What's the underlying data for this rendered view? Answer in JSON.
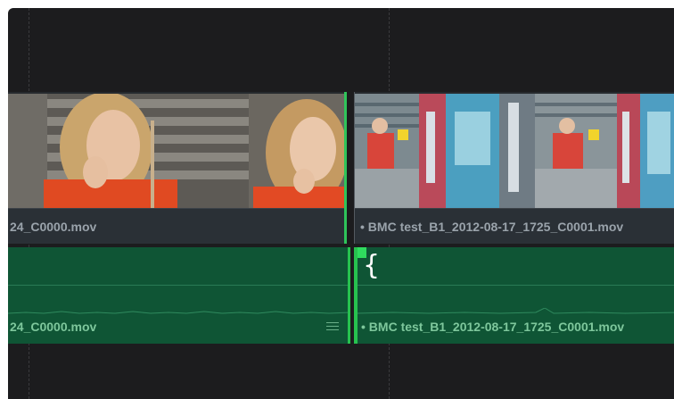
{
  "timeline": {
    "video_track": {
      "clips": [
        {
          "name": "24_C0000.mov"
        },
        {
          "name": "• BMC test_B1_2012-08-17_1725_C0001.mov"
        }
      ]
    },
    "audio_track": {
      "clips": [
        {
          "name": "24_C0000.mov"
        },
        {
          "name": "• BMC test_B1_2012-08-17_1725_C0001.mov"
        }
      ],
      "trim_cursor_glyph": "{"
    }
  },
  "colors": {
    "background": "#1c1c1e",
    "audio_clip": "#0f5535",
    "selection_edge": "#2fc45a",
    "clip_label": "#9aa3ab"
  }
}
